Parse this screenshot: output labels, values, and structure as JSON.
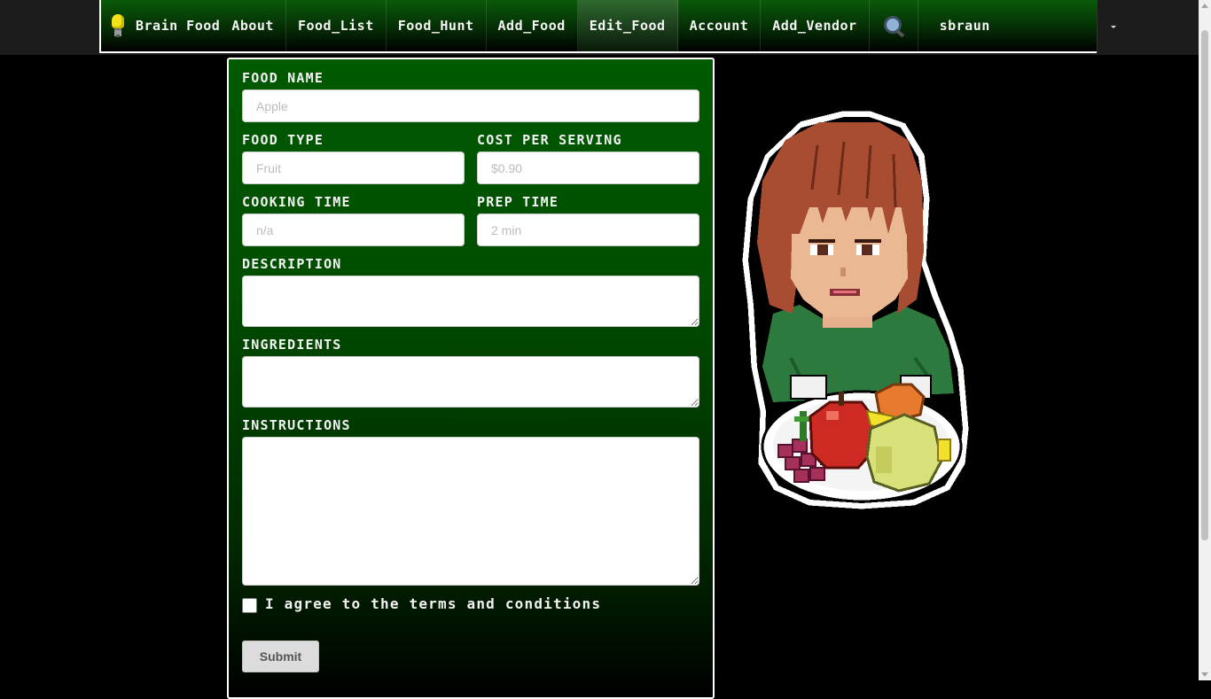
{
  "navbar": {
    "brand": "Brain Food",
    "items": [
      {
        "label": "About"
      },
      {
        "label": "Food_List"
      },
      {
        "label": "Food_Hunt"
      },
      {
        "label": "Add_Food"
      },
      {
        "label": "Edit_Food",
        "active": true
      },
      {
        "label": "Account"
      },
      {
        "label": "Add_Vendor"
      }
    ],
    "search_icon": "magnifier-icon",
    "brand_icon": "lightbulb-icon",
    "user": "sbraun"
  },
  "form": {
    "food_name": {
      "label": "FOOD NAME",
      "placeholder": "Apple",
      "value": ""
    },
    "food_type": {
      "label": "FOOD TYPE",
      "placeholder": "Fruit",
      "value": ""
    },
    "cost_per_serving": {
      "label": "COST PER SERVING",
      "placeholder": "$0.90",
      "value": ""
    },
    "cooking_time": {
      "label": "COOKING TIME",
      "placeholder": "n/a",
      "value": ""
    },
    "prep_time": {
      "label": "PREP TIME",
      "placeholder": "2 min",
      "value": ""
    },
    "description": {
      "label": "DESCRIPTION",
      "value": ""
    },
    "ingredients": {
      "label": "INGREDIENTS",
      "value": ""
    },
    "instructions": {
      "label": "INSTRUCTIONS",
      "value": ""
    },
    "terms": {
      "label": "I agree to the terms and conditions",
      "checked": false
    },
    "submit_label": "Submit"
  },
  "colors": {
    "panel_green": "#005a00",
    "nav_green": "#0a5a0a",
    "background": "#000000"
  }
}
